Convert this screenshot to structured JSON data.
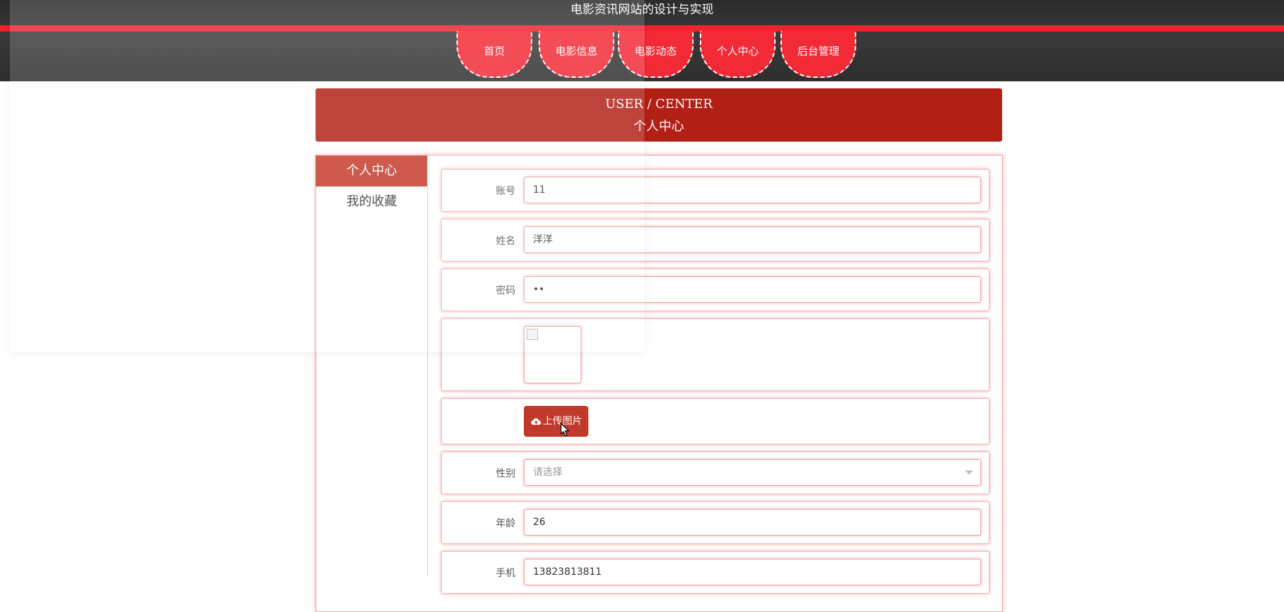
{
  "site": {
    "title": "电影资讯网站的设计与实现"
  },
  "colors": {
    "brand_red": "#f22a36",
    "banner_red": "#b21f15",
    "active_red": "#c43b2c",
    "header_dark": "#2e2e2e"
  },
  "nav": {
    "items": [
      {
        "label": "首页"
      },
      {
        "label": "电影信息"
      },
      {
        "label": "电影动态"
      },
      {
        "label": "个人中心"
      },
      {
        "label": "后台管理"
      }
    ]
  },
  "banner": {
    "en": "USER / CENTER",
    "cn": "个人中心"
  },
  "sidebar": {
    "items": [
      {
        "label": "个人中心",
        "active": true
      },
      {
        "label": "我的收藏",
        "active": false
      }
    ]
  },
  "form": {
    "account": {
      "label": "账号",
      "value": "11"
    },
    "name": {
      "label": "姓名",
      "value": "洋洋"
    },
    "password": {
      "label": "密码",
      "value": "••"
    },
    "avatar": {
      "icon": "broken-image-icon"
    },
    "upload": {
      "label": "上传图片",
      "icon": "cloud-upload-icon"
    },
    "gender": {
      "label": "性别",
      "placeholder": "请选择"
    },
    "age": {
      "label": "年龄",
      "value": "26"
    },
    "phone": {
      "label": "手机",
      "value": "13823813811"
    }
  }
}
